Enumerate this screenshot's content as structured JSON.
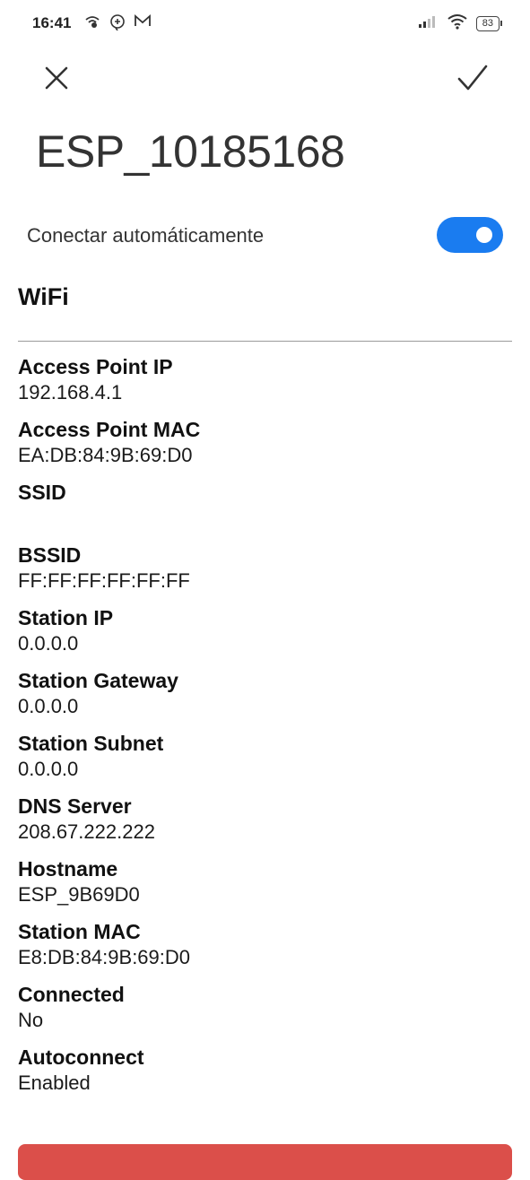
{
  "status_bar": {
    "time": "16:41",
    "left_icons": [
      "wifi-hotspot-icon",
      "messenger-icon",
      "gmail-icon"
    ],
    "right_icons": [
      "signal-icon",
      "wifi-icon",
      "battery-icon"
    ],
    "battery": "83"
  },
  "header": {
    "close_icon": "close-icon",
    "confirm_icon": "check-icon",
    "title": "ESP_10185168"
  },
  "auto_connect": {
    "label": "Conectar automáticamente",
    "enabled": true,
    "toggle_color": "#1a7cf0"
  },
  "section": {
    "title": "WiFi"
  },
  "info": [
    {
      "label": "Access Point IP",
      "value": "192.168.4.1"
    },
    {
      "label": "Access Point MAC",
      "value": "EA:DB:84:9B:69:D0"
    },
    {
      "label": "SSID",
      "value": ""
    },
    {
      "label": "BSSID",
      "value": "FF:FF:FF:FF:FF:FF"
    },
    {
      "label": "Station IP",
      "value": "0.0.0.0"
    },
    {
      "label": "Station Gateway",
      "value": "0.0.0.0"
    },
    {
      "label": "Station Subnet",
      "value": "0.0.0.0"
    },
    {
      "label": "DNS Server",
      "value": "208.67.222.222"
    },
    {
      "label": "Hostname",
      "value": "ESP_9B69D0"
    },
    {
      "label": "Station MAC",
      "value": "E8:DB:84:9B:69:D0"
    },
    {
      "label": "Connected",
      "value": "No"
    },
    {
      "label": "Autoconnect",
      "value": "Enabled"
    }
  ],
  "bottom_button": {
    "color": "#db4f4a"
  }
}
